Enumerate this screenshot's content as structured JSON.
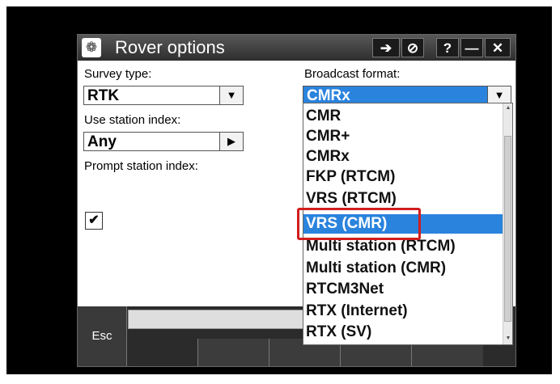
{
  "window": {
    "title": "Rover options",
    "buttons": {
      "enter": "➔",
      "close_app": "⊘",
      "help": "?",
      "minimize": "—",
      "close": "✕"
    }
  },
  "form": {
    "survey_type_label": "Survey type:",
    "survey_type_value": "RTK",
    "station_index_label": "Use station index:",
    "station_index_value": "Any",
    "prompt_station_label": "Prompt station index:",
    "prompt_checked": "✔",
    "broadcast_label": "Broadcast format:",
    "broadcast_value": "CMRx"
  },
  "dropdown": {
    "options": [
      "CMR",
      "CMR+",
      "CMRx",
      "FKP (RTCM)",
      "VRS (RTCM)",
      "VRS (CMR)",
      "Multi station (RTCM)",
      "Multi station (CMR)",
      "RTCM3Net",
      "RTX (Internet)",
      "RTX (SV)"
    ],
    "highlighted_index": 5
  },
  "bottom": {
    "esc_label": "Esc"
  },
  "colors": {
    "accent": "#2a83dd",
    "annotation": "#d21d1d"
  }
}
